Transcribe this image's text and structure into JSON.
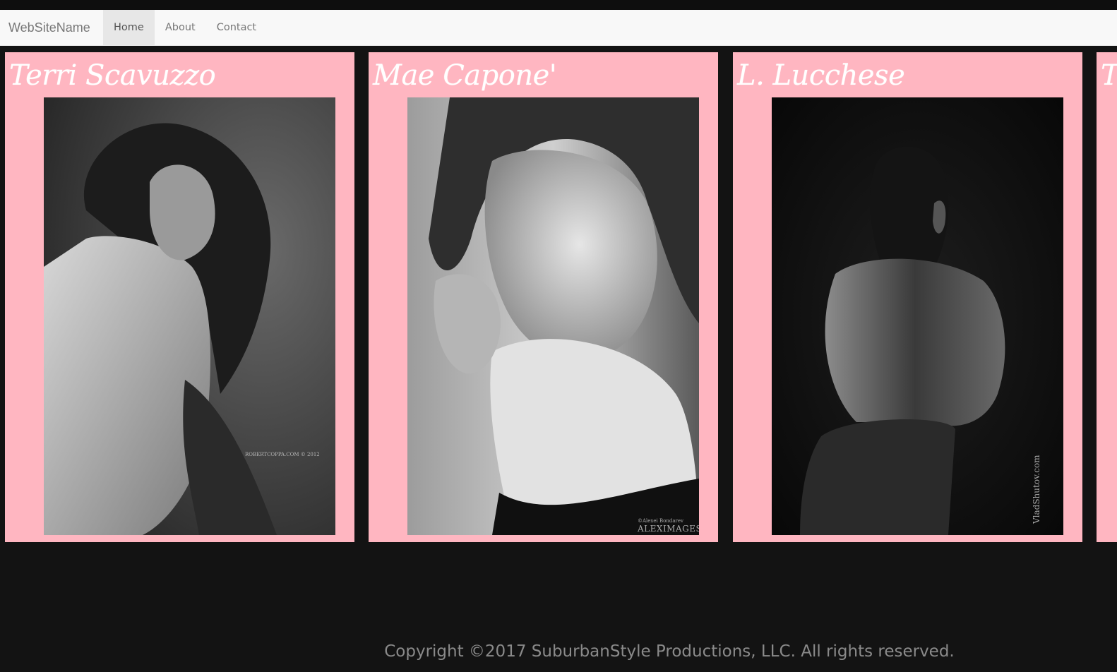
{
  "navbar": {
    "brand": "WebSiteName",
    "items": [
      {
        "label": "Home",
        "active": true
      },
      {
        "label": "About",
        "active": false
      },
      {
        "label": "Contact",
        "active": false
      }
    ]
  },
  "cards": [
    {
      "title": "Terri Scavuzzo",
      "watermark": "ROBERTCOPPA.COM © 2012"
    },
    {
      "title": "Mae Capone'",
      "watermark": "ALEXIMAGES",
      "watermark_small": "©Alexei Bondarev"
    },
    {
      "title": "L. Lucchese",
      "watermark": "VladShutov.com"
    },
    {
      "title": "T"
    }
  ],
  "footer": {
    "copyright": "Copyright ©2017 SuburbanStyle Productions, LLC. All rights reserved."
  },
  "colors": {
    "background": "#131313",
    "card": "#ffb6c1",
    "navbar": "#f8f8f8",
    "nav_active": "#e7e7e7"
  }
}
